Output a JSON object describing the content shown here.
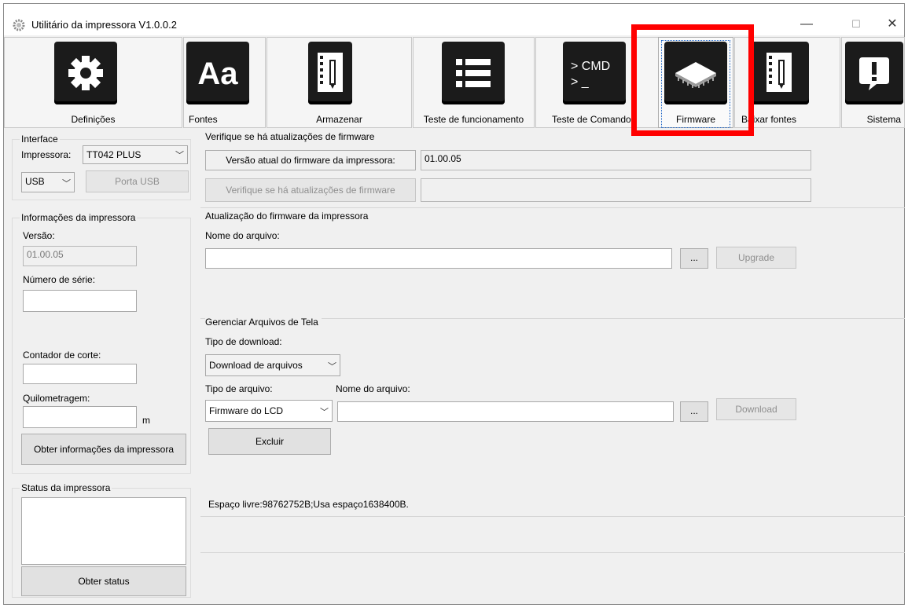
{
  "window": {
    "title": "Utilitário da impressora  V1.0.0.2",
    "minimize_glyph": "—",
    "maximize_glyph": "☐",
    "close_glyph": "✕"
  },
  "toolbar": {
    "items": [
      {
        "label": "Definições",
        "icon": "gear-icon"
      },
      {
        "label": "Fontes",
        "icon": "font-icon"
      },
      {
        "label": "Armazenar",
        "icon": "notebook-icon"
      },
      {
        "label": "Teste de funcionamento",
        "icon": "list-icon"
      },
      {
        "label": "Teste de Comando",
        "icon": "cmd-icon"
      },
      {
        "label": "Firmware",
        "icon": "chip-icon"
      },
      {
        "label": "Baixar fontes",
        "icon": "notebook-download-icon"
      },
      {
        "label": "Sistema",
        "icon": "alert-bubble-icon"
      }
    ],
    "cmd_icon_text": "> CMD\n> _"
  },
  "left": {
    "interface": {
      "title": "Interface",
      "printer_label": "Impressora:",
      "printer_value": "TT042 PLUS",
      "port_value": "USB",
      "usb_port_button": "Porta USB"
    },
    "info": {
      "title": "Informações da impressora",
      "version_label": "Versão:",
      "version_value": "01.00.05",
      "serial_label": "Número de série:",
      "serial_value": "",
      "cut_counter_label": "Contador de corte:",
      "cut_counter_value": "",
      "mileage_label": "Quilometragem:",
      "mileage_value": "",
      "mileage_unit": "m",
      "get_info_button": "Obter informações da impressora"
    },
    "status": {
      "title": "Status da impressora",
      "status_value": "",
      "get_status_button": "Obter status"
    }
  },
  "main": {
    "check": {
      "title": "Verifique se há atualizações de firmware",
      "current_version_label": "Versão atual do firmware da impressora:",
      "current_version_value": "01.00.05",
      "check_button": "Verifique se há atualizações de firmware",
      "check_result_value": ""
    },
    "update": {
      "title": "Atualização do firmware da impressora",
      "file_name_label": "Nome do arquivo:",
      "file_name_value": "",
      "browse_button": "...",
      "upgrade_button": "Upgrade"
    },
    "screen_files": {
      "title": "Gerenciar Arquivos de Tela",
      "download_type_label": "Tipo de download:",
      "download_type_value": "Download de arquivos",
      "file_type_label": "Tipo de arquivo:",
      "file_type_value": "Firmware do LCD",
      "file_name_label": "Nome do arquivo:",
      "file_name_value": "",
      "browse_button": "...",
      "download_button": "Download",
      "delete_button": "Excluir",
      "space_info": "Espaço livre:98762752B;Usa espaço1638400B."
    }
  },
  "colors": {
    "highlight": "#ff0000",
    "icon_tile": "#1b1b1b",
    "window_bg": "#f0f0f0"
  }
}
